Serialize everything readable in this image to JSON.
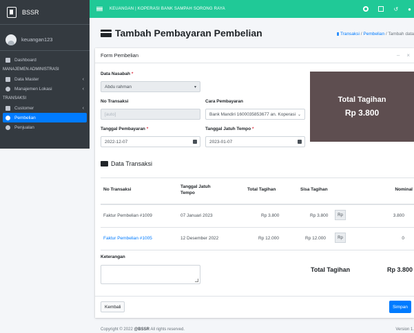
{
  "brand": {
    "name": "BSSR"
  },
  "user": {
    "name": "keuangan123"
  },
  "sidebar": {
    "dashboard": "Dashboard",
    "header_master": "MANAJEMEN ADMINISTRASI",
    "data_master": "Data Master",
    "manajemen_lokasi": "Manajemen Lokasi",
    "header_transaksi": "TRANSAKSI",
    "customer": "Customer",
    "pembelian": "Pembelian",
    "penjualan": "Penjualan"
  },
  "topbar": {
    "title": "KEUANGAN | KOPERASI BANK SAMPAH SORONG RAYA"
  },
  "page": {
    "title": "Tambah Pembayaran Pembelian",
    "breadcrumb": {
      "transaksi": "Transaksi",
      "sep1": " / ",
      "pembelian": "Pembelian",
      "sep2": " / ",
      "current": "Tambah data"
    }
  },
  "form": {
    "header": "Form Pembelian",
    "data_nasabah_label": "Data Nasabah",
    "data_nasabah_value": "Abdu rahman",
    "no_transaksi_label": "No Transaksi",
    "no_transaksi_value": "[auto]",
    "cara_pembayaran_label": "Cara Pembayaran",
    "cara_pembayaran_value": "Bank Mandiri 1600035853677 an. Koperasi",
    "tgl_pembayaran_label": "Tanggal Pembayaran",
    "tgl_pembayaran_value": "2022-12-07",
    "tgl_jatuh_tempo_label": "Tanggal Jatuh Tempo",
    "tgl_jatuh_tempo_value": "2023-01-07",
    "required_mark": "*"
  },
  "total_box": {
    "label": "Total Tagihan",
    "value": "Rp 3.800"
  },
  "data_transaksi": {
    "title": "Data Transaksi",
    "columns": {
      "no_transaksi": "No Transaksi",
      "jatuh_tempo_1": "Tanggal Jatuh",
      "jatuh_tempo_2": "Tempo",
      "total_tagihan": "Total Tagihan",
      "sisa_tagihan": "Sisa Tagihan",
      "nominal": "Nominal"
    },
    "rows": [
      {
        "no": "Faktur Pembelian #1009",
        "tempo": "07 Januari 2023",
        "total": "Rp 3.800",
        "sisa": "Rp 3.800",
        "rp": "Rp",
        "nominal": "3.800"
      },
      {
        "no": "Faktur Pembelian #1005",
        "tempo": "12 Desember 2022",
        "total": "Rp 12.000",
        "sisa": "Rp 12.000",
        "rp": "Rp",
        "nominal": "0"
      }
    ]
  },
  "keterangan_label": "Keterangan",
  "summary": {
    "label": "Total Tagihan",
    "value": "Rp 3.800"
  },
  "buttons": {
    "kembali": "Kembali",
    "simpan": "Simpan"
  },
  "footer": {
    "copyright_prefix": "Copyright © 2022 ",
    "brand": "@BSSR",
    "suffix": " All rights reserved.",
    "version": "Version 1."
  },
  "colors": {
    "topbar": "#20c997",
    "sidebar": "#343a40",
    "accent": "#007bff",
    "total_box": "#5e4e50"
  }
}
